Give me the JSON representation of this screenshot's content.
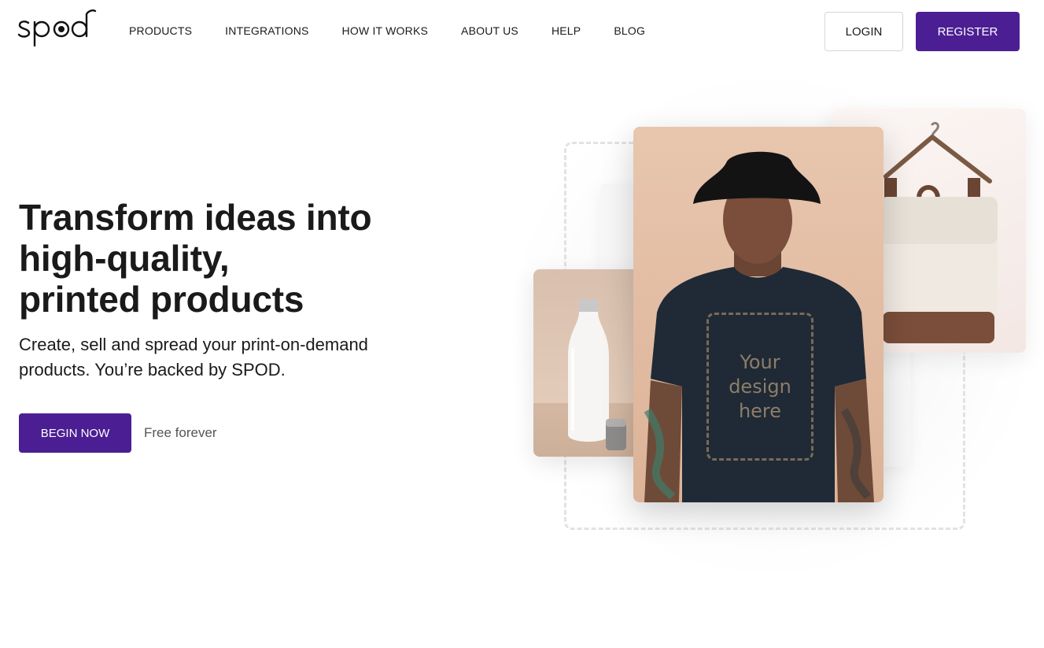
{
  "header": {
    "logo_text": "spod",
    "nav": [
      {
        "label": "PRODUCTS"
      },
      {
        "label": "INTEGRATIONS"
      },
      {
        "label": "HOW IT WORKS"
      },
      {
        "label": "ABOUT US"
      },
      {
        "label": "HELP"
      },
      {
        "label": "BLOG"
      }
    ],
    "login_label": "LOGIN",
    "register_label": "REGISTER"
  },
  "hero": {
    "title_lines": [
      "Transform ideas into",
      "high-quality,",
      "printed products"
    ],
    "subtitle": "Create, sell and spread your print-on-demand products. You’re backed by SPOD.",
    "cta_label": "BEGIN NOW",
    "cta_note": "Free forever"
  },
  "visual": {
    "design_placeholder_lines": [
      "Your",
      "design",
      "here"
    ]
  },
  "colors": {
    "brand": "#4b1f93",
    "text": "#1a1a1a",
    "muted": "#555555"
  }
}
